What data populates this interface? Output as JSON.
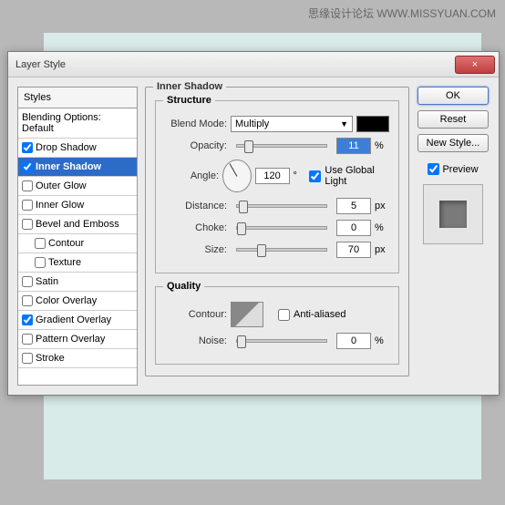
{
  "watermark": "思缘设计论坛 WWW.MISSYUAN.COM",
  "dialog_title": "Layer Style",
  "styles_header": "Styles",
  "blending_header": "Blending Options: Default",
  "styles": [
    {
      "label": "Drop Shadow",
      "checked": true
    },
    {
      "label": "Inner Shadow",
      "checked": true,
      "selected": true
    },
    {
      "label": "Outer Glow",
      "checked": false
    },
    {
      "label": "Inner Glow",
      "checked": false
    },
    {
      "label": "Bevel and Emboss",
      "checked": false
    },
    {
      "label": "Contour",
      "checked": false,
      "indent": true
    },
    {
      "label": "Texture",
      "checked": false,
      "indent": true
    },
    {
      "label": "Satin",
      "checked": false
    },
    {
      "label": "Color Overlay",
      "checked": false
    },
    {
      "label": "Gradient Overlay",
      "checked": true
    },
    {
      "label": "Pattern Overlay",
      "checked": false
    },
    {
      "label": "Stroke",
      "checked": false
    }
  ],
  "panel_title": "Inner Shadow",
  "structure": {
    "title": "Structure",
    "blend_mode_label": "Blend Mode:",
    "blend_mode_value": "Multiply",
    "opacity_label": "Opacity:",
    "opacity_value": "11",
    "opacity_unit": "%",
    "angle_label": "Angle:",
    "angle_value": "120",
    "angle_unit": "°",
    "global_light_label": "Use Global Light",
    "distance_label": "Distance:",
    "distance_value": "5",
    "distance_unit": "px",
    "choke_label": "Choke:",
    "choke_value": "0",
    "choke_unit": "%",
    "size_label": "Size:",
    "size_value": "70",
    "size_unit": "px"
  },
  "quality": {
    "title": "Quality",
    "contour_label": "Contour:",
    "antialiased_label": "Anti-aliased",
    "noise_label": "Noise:",
    "noise_value": "0",
    "noise_unit": "%"
  },
  "buttons": {
    "ok": "OK",
    "reset": "Reset",
    "new_style": "New Style...",
    "preview": "Preview"
  }
}
